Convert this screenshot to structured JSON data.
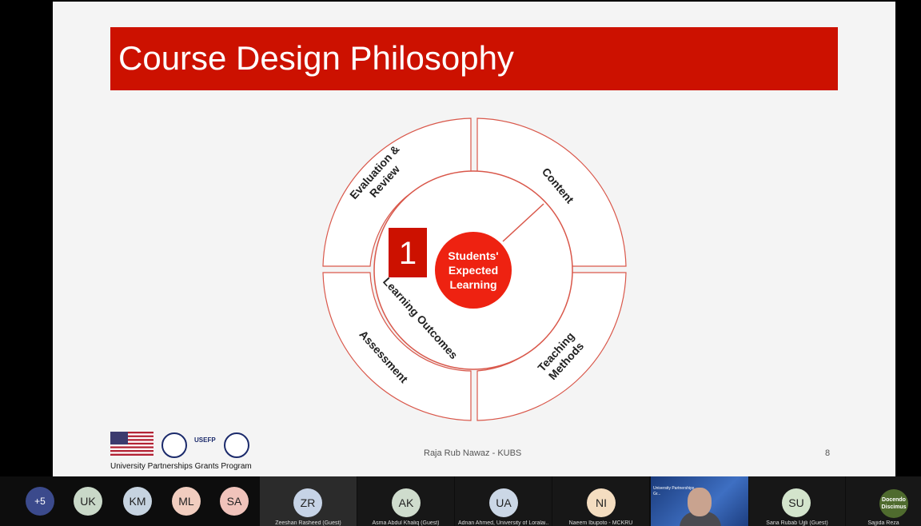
{
  "slide": {
    "title": "Course Design Philosophy",
    "segments": {
      "content": "Content",
      "teaching": [
        "Teaching",
        "Methods"
      ],
      "assessment": "Assessment",
      "evaluation": [
        "Evaluation &",
        "Review"
      ]
    },
    "inner_label": "Learning Outcomes",
    "center": [
      "Students'",
      "Expected",
      "Learning"
    ],
    "step_number": "1",
    "footer_name": "Raja Rub Nawaz - KUBS",
    "page_number": "8",
    "program": "University Partnerships Grants Program",
    "logo_text": "USEFP",
    "colors": {
      "brand_red": "#cc1100",
      "circle_red": "#ee2211",
      "ring": "#d9574a"
    }
  },
  "participants": [
    {
      "initials": "+5",
      "color": "#3b4a8c",
      "name": ""
    },
    {
      "initials": "UK",
      "color": "#c9d8c8",
      "name": ""
    },
    {
      "initials": "KM",
      "color": "#c6d3e0",
      "name": ""
    },
    {
      "initials": "ML",
      "color": "#f1cdbf",
      "name": ""
    },
    {
      "initials": "SA",
      "color": "#f0c3bb",
      "name": ""
    },
    {
      "initials": "ZR",
      "color": "#c6d3e6",
      "name": "Zeeshan Rasheed (Guest)"
    },
    {
      "initials": "AK",
      "color": "#cfdccd",
      "name": "Asma Abdul Khaliq (Guest)"
    },
    {
      "initials": "UA",
      "color": "#cbd7e6",
      "name": "Adnan Ahmed, University of Loralai..."
    },
    {
      "initials": "NI",
      "color": "#f4ddc0",
      "name": "Naeem Ibupoto - MCKRU"
    },
    {
      "initials": "SU",
      "color": "#d3e4cc",
      "name": "Sana Rubab Ujjli (Guest)"
    }
  ],
  "video_tile": {
    "caption": "University Partnerships Gr..."
  },
  "last_tile": {
    "bubble_text": "Docendo Discimus",
    "name": "Sajjida Reza"
  }
}
